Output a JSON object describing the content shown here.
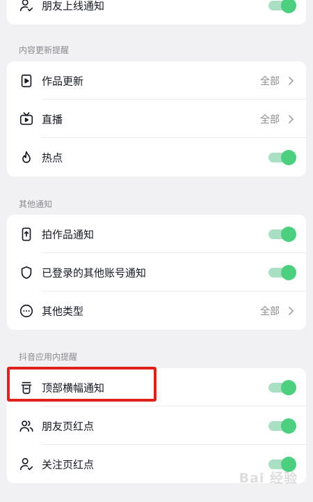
{
  "colors": {
    "toggle_on": "#4cd080",
    "toggle_track": "#a9dfc3",
    "highlight_border": "#e0201a",
    "background": "#f1f1f3"
  },
  "top_section": {
    "rows": [
      {
        "label": "朋友上线通知",
        "icon": "user-check-icon",
        "toggle": true
      }
    ]
  },
  "content_updates": {
    "title": "内容更新提醒",
    "rows": [
      {
        "label": "作品更新",
        "icon": "play-document-icon",
        "value": "全部"
      },
      {
        "label": "直播",
        "icon": "tv-play-icon",
        "value": "全部"
      },
      {
        "label": "热点",
        "icon": "flame-icon",
        "toggle": true
      }
    ]
  },
  "other_notifications": {
    "title": "其他通知",
    "rows": [
      {
        "label": "拍作品通知",
        "icon": "phone-upload-icon",
        "toggle": true
      },
      {
        "label": "已登录的其他账号通知",
        "icon": "shield-icon",
        "toggle": true
      },
      {
        "label": "其他类型",
        "icon": "more-circle-icon",
        "value": "全部"
      }
    ]
  },
  "in_app_reminders": {
    "title": "抖音应用内提醒",
    "rows": [
      {
        "label": "顶部横幅通知",
        "icon": "banner-cup-icon",
        "toggle": true
      },
      {
        "label": "朋友页红点",
        "icon": "friends-icon",
        "toggle": true
      },
      {
        "label": "关注页红点",
        "icon": "user-check-icon",
        "toggle": true
      }
    ]
  },
  "watermark": "Bai 经验"
}
